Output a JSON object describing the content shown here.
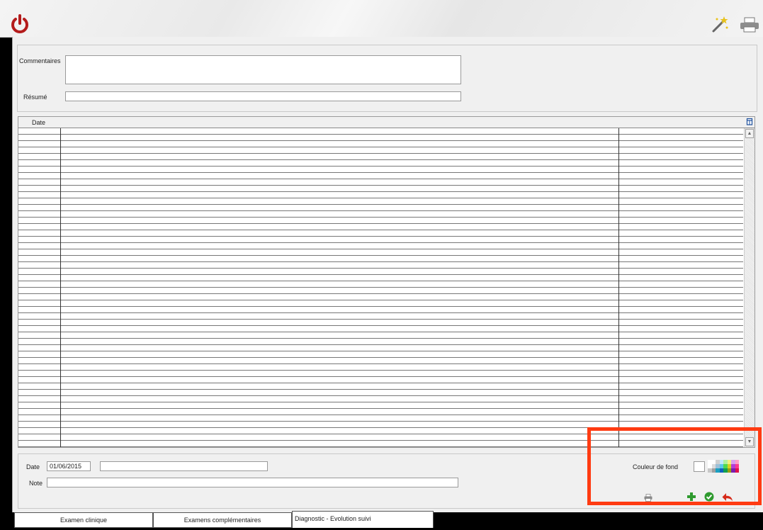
{
  "toolbar": {
    "power_icon": "power-icon",
    "wand_icon": "magic-wand-icon",
    "print_icon": "printer-icon"
  },
  "form": {
    "commentaires_label": "Commentaires",
    "commentaires_value": "",
    "resume_label": "Résumé",
    "resume_value": ""
  },
  "grid": {
    "columns": [
      "Date",
      "",
      ""
    ],
    "rows": []
  },
  "entry": {
    "date_label": "Date",
    "date_value": "01/06/2015",
    "date_extra_value": "",
    "note_label": "Note",
    "note_value": "",
    "background_color_label": "Couleur de fond"
  },
  "actions": {
    "print": "printer-icon",
    "add": "plus-icon",
    "validate": "check-icon",
    "undo": "undo-icon"
  },
  "colors": {
    "highlight": "#ff3b12",
    "add": "#2e9a2e",
    "validate": "#2e9a2e",
    "undo": "#d62a1a",
    "power": "#b41c1c"
  },
  "tabs": [
    {
      "label": "Examen clinique",
      "active": false
    },
    {
      "label": "Examens complémentaires",
      "active": false
    },
    {
      "label": "Diagnostic - Evolution suivi",
      "active": true
    }
  ]
}
